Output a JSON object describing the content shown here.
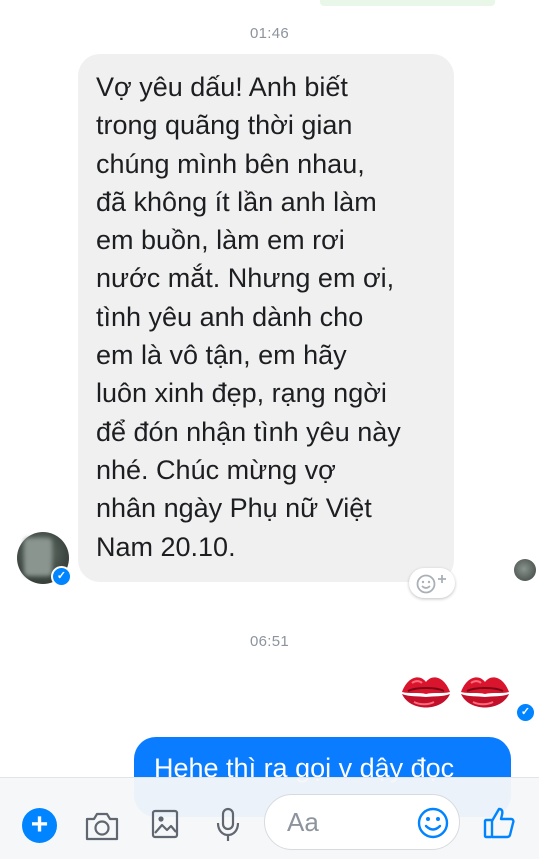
{
  "thread": {
    "timestamp_1": "01:46",
    "timestamp_2": "06:51",
    "incoming_message_lines": [
      "Vợ yêu dấu! Anh biết",
      "trong quãng thời gian",
      "chúng mình bên nhau,",
      "đã không ít lần anh làm",
      "em buồn, làm em rơi",
      "nước mắt. Nhưng em ơi,",
      "tình yêu anh dành cho",
      "em là vô tận, em hãy",
      "luôn xinh đẹp, rạng ngời",
      "để đón nhận tình yêu này",
      "nhé. Chúc mừng vợ",
      "nhân ngày Phụ nữ Việt",
      "Nam 20.10."
    ],
    "outgoing_message": "Hehe thì ra gọi v dậy đọc",
    "verified_mark": "✓"
  },
  "composer": {
    "plus_label": "+",
    "placeholder": "Aa",
    "icons": [
      "plus-icon",
      "camera-icon",
      "image-icon",
      "microphone-icon",
      "emoji-icon",
      "thumbs-up-icon"
    ]
  },
  "colors": {
    "messenger_blue": "#0084ff",
    "outgoing_bubble": "#0a7cff",
    "incoming_bubble": "#f1f0f0",
    "timestamp": "#8d949e",
    "kiss_red": "#d8152d"
  }
}
